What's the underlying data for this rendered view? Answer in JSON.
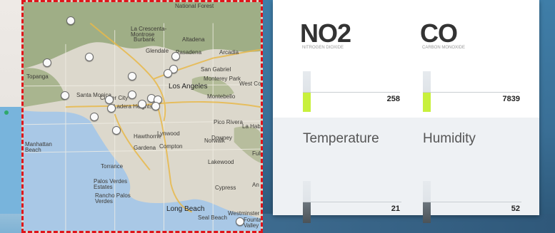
{
  "map": {
    "labels": [
      {
        "text": "National Forest",
        "big": false
      },
      {
        "text": "La Crescenta-Montrose",
        "big": false
      },
      {
        "text": "Burbank",
        "big": false
      },
      {
        "text": "Altadena",
        "big": false
      },
      {
        "text": "Glendale",
        "big": false
      },
      {
        "text": "Pasadena",
        "big": false
      },
      {
        "text": "Arcadia",
        "big": false
      },
      {
        "text": "Topanga",
        "big": false
      },
      {
        "text": "San Gabriel",
        "big": false
      },
      {
        "text": "Monterey Park",
        "big": false
      },
      {
        "text": "West Co",
        "big": false
      },
      {
        "text": "Los Angeles",
        "big": true
      },
      {
        "text": "Santa Monica",
        "big": false
      },
      {
        "text": "Culver City",
        "big": false
      },
      {
        "text": "Montebello",
        "big": false
      },
      {
        "text": "Ladera Heights",
        "big": false
      },
      {
        "text": "Pico Rivera",
        "big": false
      },
      {
        "text": "Downey",
        "big": false
      },
      {
        "text": "La Hab",
        "big": false
      },
      {
        "text": "Hawthorne",
        "big": false
      },
      {
        "text": "Lynwood",
        "big": false
      },
      {
        "text": "Norwalk",
        "big": false
      },
      {
        "text": "Manhattan Beach",
        "big": false
      },
      {
        "text": "Gardena",
        "big": false
      },
      {
        "text": "Compton",
        "big": false
      },
      {
        "text": "Fulle",
        "big": false
      },
      {
        "text": "Torrance",
        "big": false
      },
      {
        "text": "Lakewood",
        "big": false
      },
      {
        "text": "Cypress",
        "big": false
      },
      {
        "text": "Palos Verdes Estates",
        "big": false
      },
      {
        "text": "An",
        "big": false
      },
      {
        "text": "Rancho Palos Verdes",
        "big": false
      },
      {
        "text": "Long Beach",
        "big": true
      },
      {
        "text": "Seal Beach",
        "big": false
      },
      {
        "text": "Westminster",
        "big": false
      },
      {
        "text": "Fountain Valley",
        "big": false
      }
    ],
    "pin_count": 17
  },
  "sensors": {
    "no2": {
      "title": "NO2",
      "subtitle": "NITROGEN DIOXIDE",
      "value": "258",
      "fill_color": "#c8f03c"
    },
    "co": {
      "title": "CO",
      "subtitle": "CARBON MONOXIDE",
      "value": "7839",
      "fill_color": "#c8f03c"
    },
    "temperature": {
      "title": "Temperature",
      "value": "21",
      "fill_color": "#4a5258"
    },
    "humidity": {
      "title": "Humidity",
      "value": "52",
      "fill_color": "#4a5258"
    }
  },
  "colors": {
    "selection_border": "#e0141a",
    "background": "#3a6f96"
  }
}
